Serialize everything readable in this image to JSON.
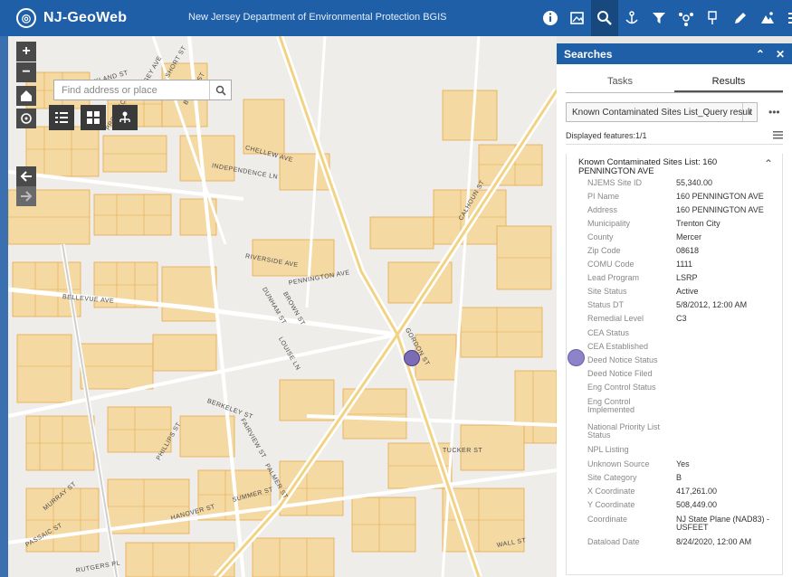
{
  "header": {
    "app_title": "NJ-GeoWeb",
    "subtitle": "New Jersey Department of Environmental Protection   BGIS",
    "tools": [
      "info-icon",
      "map-layers-icon",
      "search-results-icon",
      "anchor-icon",
      "filter-icon",
      "share-icon",
      "edit-marker-icon",
      "pencil-icon",
      "print-icon",
      "menu-icon"
    ]
  },
  "map": {
    "search": {
      "placeholder": "Find address or place",
      "value": ""
    },
    "controls": [
      "zoom-in",
      "zoom-out",
      "home",
      "locate",
      "back",
      "forward"
    ],
    "street_labels": [
      "OAKLAND ST",
      "PROSPECT ST",
      "KELSEY AVE",
      "BROOK ST",
      "SHORT ST",
      "CHELLEW AVE",
      "INDEPENDENCE LN",
      "PENNINGTON AVE",
      "RIVERSIDE AVE",
      "BELLEVUE AVE",
      "DUNHAM ST",
      "BROWN ST",
      "LOUISE LN",
      "GORDON ST",
      "BERKELEY ST",
      "FAIRVIEW ST",
      "PALMER ST",
      "PHILLIPS ST",
      "HANOVER ST",
      "SUMMER ST",
      "MURRAY ST",
      "PASSAIC ST",
      "RUTGERS PL",
      "TUCKER ST",
      "CALHOUN ST",
      "WALL ST"
    ],
    "colors": {
      "parcel": "#e8a94a",
      "road": "#ffffff",
      "base": "#efedea",
      "marker": "#7a6cb5"
    }
  },
  "panel": {
    "title": "Searches",
    "tabs": [
      "Tasks",
      "Results"
    ],
    "active_tab": "Results",
    "layer_select": "Known Contaminated Sites List_Query result",
    "displayed": "Displayed features:1/1",
    "feature_title": "Known Contaminated Sites List: 160 PENNINGTON AVE",
    "attributes": [
      {
        "name": "NJEMS Site ID",
        "value": "55,340.00"
      },
      {
        "name": "PI Name",
        "value": "160 PENNINGTON AVE"
      },
      {
        "name": "Address",
        "value": "160 PENNINGTON AVE"
      },
      {
        "name": "Municipality",
        "value": "Trenton City"
      },
      {
        "name": "County",
        "value": "Mercer"
      },
      {
        "name": "Zip Code",
        "value": "08618"
      },
      {
        "name": "COMU Code",
        "value": "1111"
      },
      {
        "name": "Lead Program",
        "value": "LSRP"
      },
      {
        "name": "Site Status",
        "value": "Active"
      },
      {
        "name": "Status DT",
        "value": "5/8/2012, 12:00 AM"
      },
      {
        "name": "Remedial Level",
        "value": "C3"
      },
      {
        "name": "CEA Status",
        "value": ""
      },
      {
        "name": "CEA Established",
        "value": ""
      },
      {
        "name": "Deed Notice Status",
        "value": ""
      },
      {
        "name": "Deed Notice Filed",
        "value": ""
      },
      {
        "name": "Eng Control Status",
        "value": ""
      },
      {
        "name": "Eng Control Implemented",
        "value": ""
      },
      {
        "name": "National Priority List Status",
        "value": ""
      },
      {
        "name": "NPL Listing",
        "value": ""
      },
      {
        "name": "Unknown Source",
        "value": "Yes"
      },
      {
        "name": "Site Category",
        "value": "B"
      },
      {
        "name": "X Coordinate",
        "value": "417,261.00"
      },
      {
        "name": "Y Coordinate",
        "value": "508,449.00"
      },
      {
        "name": "Coordinate",
        "value": "NJ State Plane (NAD83) - USFEET"
      },
      {
        "name": "Dataload Date",
        "value": "8/24/2020, 12:00 AM"
      }
    ]
  }
}
